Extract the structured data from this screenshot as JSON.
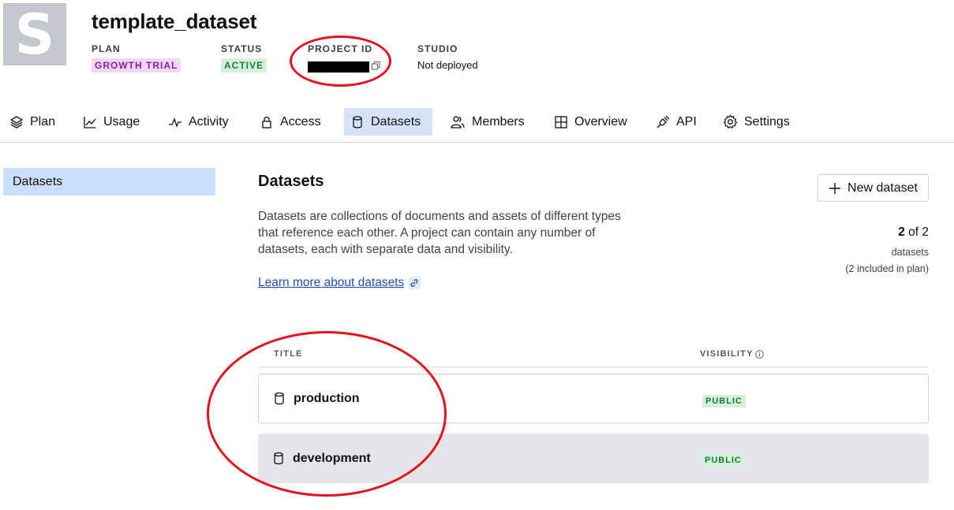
{
  "project": {
    "avatar_letter": "S",
    "title": "template_dataset",
    "plan_label": "PLAN",
    "plan_value": "GROWTH TRIAL",
    "status_label": "STATUS",
    "status_value": "ACTIVE",
    "project_id_label": "PROJECT ID",
    "studio_label": "STUDIO",
    "studio_value": "Not deployed"
  },
  "tabs": [
    {
      "label": "Plan",
      "icon": "stack-icon"
    },
    {
      "label": "Usage",
      "icon": "line-chart-icon"
    },
    {
      "label": "Activity",
      "icon": "activity-icon"
    },
    {
      "label": "Access",
      "icon": "lock-icon"
    },
    {
      "label": "Datasets",
      "icon": "database-icon",
      "active": true
    },
    {
      "label": "Members",
      "icon": "users-icon"
    },
    {
      "label": "Overview",
      "icon": "grid-icon"
    },
    {
      "label": "API",
      "icon": "plug-icon"
    },
    {
      "label": "Settings",
      "icon": "gear-icon"
    }
  ],
  "sidebar": {
    "items": [
      {
        "label": "Datasets",
        "active": true
      }
    ]
  },
  "main": {
    "heading": "Datasets",
    "description": "Datasets are collections of documents and assets of different types that reference each other. A project can contain any number of datasets, each with separate data and visibility.",
    "learn_more": "Learn more about datasets",
    "new_button": "New dataset",
    "count_used": "2",
    "count_of": "of 2",
    "count_unit": "datasets",
    "count_note": "(2 included in plan)"
  },
  "table": {
    "col_title": "TITLE",
    "col_visibility": "VISIBILITY",
    "rows": [
      {
        "title": "production",
        "visibility": "PUBLIC"
      },
      {
        "title": "development",
        "visibility": "PUBLIC"
      }
    ]
  },
  "colors": {
    "accent": "#ccdffa",
    "annotation": "#e3121f",
    "public_badge": "#d4f1dc",
    "plan_badge": "#f1d7f6"
  }
}
